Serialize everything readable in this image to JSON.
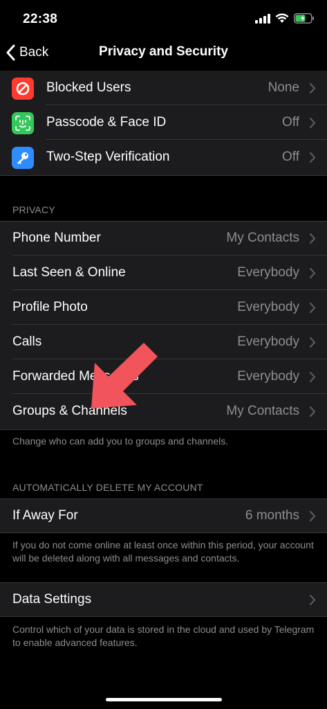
{
  "status_bar": {
    "time": "22:38"
  },
  "nav": {
    "back_label": "Back",
    "title": "Privacy and Security"
  },
  "security_rows": [
    {
      "label": "Blocked Users",
      "value": "None",
      "icon": "blocked-icon",
      "color": "#ff3b30"
    },
    {
      "label": "Passcode & Face ID",
      "value": "Off",
      "icon": "face-id-icon",
      "color": "#34c759"
    },
    {
      "label": "Two-Step Verification",
      "value": "Off",
      "icon": "key-icon",
      "color": "#2f8cff"
    }
  ],
  "privacy": {
    "header": "PRIVACY",
    "rows": [
      {
        "label": "Phone Number",
        "value": "My Contacts"
      },
      {
        "label": "Last Seen & Online",
        "value": "Everybody"
      },
      {
        "label": "Profile Photo",
        "value": "Everybody"
      },
      {
        "label": "Calls",
        "value": "Everybody"
      },
      {
        "label": "Forwarded Messages",
        "value": "Everybody"
      },
      {
        "label": "Groups & Channels",
        "value": "My Contacts"
      }
    ],
    "footer": "Change who can add you to groups and channels."
  },
  "auto_delete": {
    "header": "AUTOMATICALLY DELETE MY ACCOUNT",
    "row": {
      "label": "If Away For",
      "value": "6 months"
    },
    "footer": "If you do not come online at least once within this period, your account will be deleted along with all messages and contacts."
  },
  "data_settings": {
    "row": {
      "label": "Data Settings"
    },
    "footer": "Control which of your data is stored in the cloud and used by Telegram to enable advanced features."
  },
  "annotation": {
    "arrow_color": "#f2545b"
  }
}
